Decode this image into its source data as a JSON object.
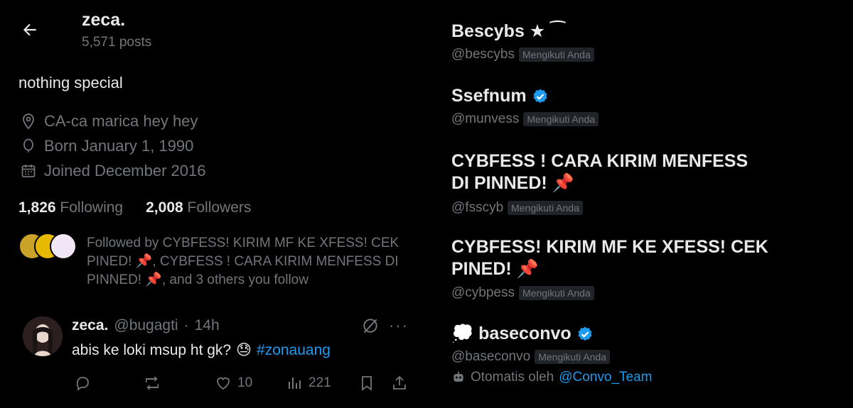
{
  "profile": {
    "display_name": "zeca.",
    "post_count": "5,571 posts",
    "bio": "nothing special",
    "location": "CA-ca marica hey hey",
    "birthday": "Born January 1, 1990",
    "joined": "Joined December 2016",
    "following_count": "1,826",
    "following_label": "Following",
    "followers_count": "2,008",
    "followers_label": "Followers",
    "followed_by": "Followed by CYBFESS! KIRIM MF KE XFESS! CEK PINED! 📌, CYBFESS ! CARA KIRIM MENFESS DI PINNED! 📌, and 3 others you follow"
  },
  "tweet": {
    "name": "zeca.",
    "handle": "@bugagti",
    "separator": "·",
    "time": "14h",
    "text": "abis ke loki msup ht gk?",
    "emoji": "😓",
    "hashtag": "#zonauang",
    "likes": "10",
    "views": "221"
  },
  "followers_list": [
    {
      "name": "Bescybs ★ ⁀",
      "handle": "@bescybs",
      "badge": "Mengikuti Anda",
      "verified": false
    },
    {
      "name": "Ssefnum",
      "handle": "@munvess",
      "badge": "Mengikuti Anda",
      "verified": true
    },
    {
      "name": "CYBFESS ! CARA KIRIM MENFESS",
      "name_line2": "DI PINNED! 📌",
      "handle": "@fsscyb",
      "badge": "Mengikuti Anda",
      "verified": false
    },
    {
      "name": "CYBFESS! KIRIM MF KE XFESS! CEK",
      "name_line2": "PINED! 📌",
      "handle": "@cybpess",
      "badge": "Mengikuti Anda",
      "verified": false
    },
    {
      "name": "💭 baseconvo",
      "handle": "@baseconvo",
      "badge": "Mengikuti Anda",
      "verified": true,
      "automated_prefix": "Otomatis oleh",
      "automated_by": "@Convo_Team"
    }
  ],
  "colors": {
    "accent": "#1d9bf0",
    "muted": "#71767b",
    "text": "#e7e9ea",
    "background": "#000000"
  }
}
